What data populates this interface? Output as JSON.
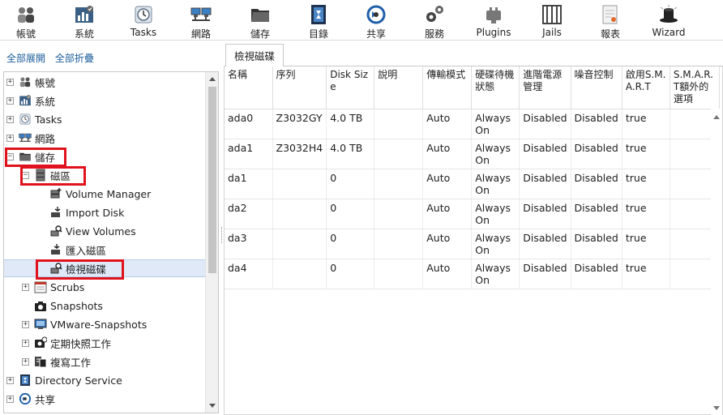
{
  "toolbar": [
    {
      "label": "帳號",
      "icon": "users-icon"
    },
    {
      "label": "系統",
      "icon": "system-icon"
    },
    {
      "label": "Tasks",
      "icon": "tasks-icon"
    },
    {
      "label": "網路",
      "icon": "network-icon"
    },
    {
      "label": "儲存",
      "icon": "storage-icon"
    },
    {
      "label": "目錄",
      "icon": "directory-icon"
    },
    {
      "label": "共享",
      "icon": "sharing-icon"
    },
    {
      "label": "服務",
      "icon": "services-icon"
    },
    {
      "label": "Plugins",
      "icon": "plugins-icon"
    },
    {
      "label": "Jails",
      "icon": "jails-icon"
    },
    {
      "label": "報表",
      "icon": "reports-icon"
    },
    {
      "label": "Wizard",
      "icon": "wizard-icon"
    }
  ],
  "left": {
    "expand_all": "全部展開",
    "collapse_all": "全部折疊",
    "tree": [
      {
        "label": "帳號",
        "expander": "+",
        "icon": "users-icon"
      },
      {
        "label": "系統",
        "expander": "+",
        "icon": "system-icon"
      },
      {
        "label": "Tasks",
        "expander": "+",
        "icon": "tasks-icon"
      },
      {
        "label": "網路",
        "expander": "+",
        "icon": "network-icon"
      },
      {
        "label": "儲存",
        "expander": "−",
        "icon": "storage-icon"
      },
      {
        "label": "磁區",
        "expander": "−",
        "icon": "volumes-icon"
      },
      {
        "label": "Volume Manager",
        "expander": "",
        "icon": "volume-manager-icon"
      },
      {
        "label": "Import Disk",
        "expander": "",
        "icon": "import-disk-icon"
      },
      {
        "label": "View Volumes",
        "expander": "",
        "icon": "view-volumes-icon"
      },
      {
        "label": "匯入磁區",
        "expander": "",
        "icon": "import-volume-icon"
      },
      {
        "label": "檢視磁碟",
        "expander": "",
        "icon": "view-disks-icon"
      },
      {
        "label": "Scrubs",
        "expander": "+",
        "icon": "scrubs-icon"
      },
      {
        "label": "Snapshots",
        "expander": "",
        "icon": "snapshots-icon"
      },
      {
        "label": "VMware-Snapshots",
        "expander": "+",
        "icon": "vmware-snapshots-icon"
      },
      {
        "label": "定期快照工作",
        "expander": "+",
        "icon": "periodic-snapshot-icon"
      },
      {
        "label": "複寫工作",
        "expander": "+",
        "icon": "replication-icon"
      },
      {
        "label": "Directory Service",
        "expander": "+",
        "icon": "directory-service-icon"
      },
      {
        "label": "共享",
        "expander": "+",
        "icon": "sharing-icon"
      }
    ]
  },
  "main": {
    "tab": "檢視磁碟",
    "columns": [
      "名稱",
      "序列",
      "Disk Size",
      "說明",
      "傳輸模式",
      "硬碟待機狀態",
      "進階電源管理",
      "噪音控制",
      "啟用S.M.A.R.T",
      "S.M.A.R.T額外的選項"
    ],
    "rows": [
      [
        "ada0",
        "Z3032GY",
        "4.0 TB",
        "",
        "Auto",
        "Always On",
        "Disabled",
        "Disabled",
        "true",
        ""
      ],
      [
        "ada1",
        "Z3032H4",
        "4.0 TB",
        "",
        "Auto",
        "Always On",
        "Disabled",
        "Disabled",
        "true",
        ""
      ],
      [
        "da1",
        "",
        "0",
        "",
        "Auto",
        "Always On",
        "Disabled",
        "Disabled",
        "true",
        ""
      ],
      [
        "da2",
        "",
        "0",
        "",
        "Auto",
        "Always On",
        "Disabled",
        "Disabled",
        "true",
        ""
      ],
      [
        "da3",
        "",
        "0",
        "",
        "Auto",
        "Always On",
        "Disabled",
        "Disabled",
        "true",
        ""
      ],
      [
        "da4",
        "",
        "0",
        "",
        "Auto",
        "Always On",
        "Disabled",
        "Disabled",
        "true",
        ""
      ]
    ]
  },
  "colors": {
    "highlight": "#e0131c",
    "link": "#1a5c9a",
    "selected_row": "#dfe9f7"
  }
}
